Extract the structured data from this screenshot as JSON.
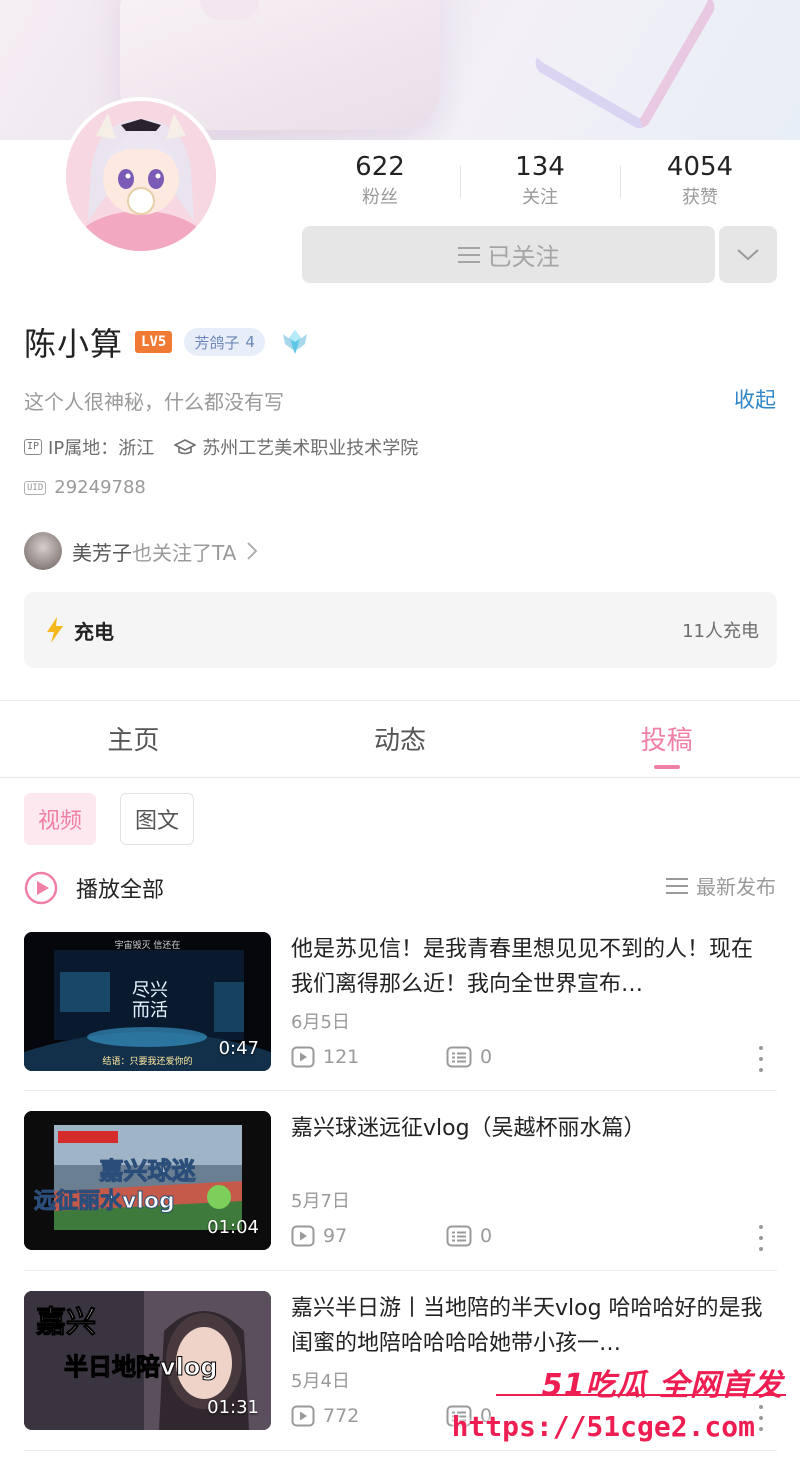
{
  "profile": {
    "stats": [
      {
        "value": "622",
        "label": "粉丝"
      },
      {
        "value": "134",
        "label": "关注"
      },
      {
        "value": "4054",
        "label": "获赞"
      }
    ],
    "follow_label": "已关注",
    "name": "陈小算",
    "level_badge": "LV5",
    "fan_badge_name": "芳鸽子",
    "fan_badge_level": "4",
    "bio": "这个人很神秘，什么都没有写",
    "collapse_label": "收起",
    "ip_tag": "IP",
    "ip_location": "IP属地：浙江",
    "school": "苏州工艺美术职业技术学院",
    "uid_tag": "UID",
    "uid": "29249788",
    "mutual_name": "美芳子",
    "mutual_text": "也关注了TA",
    "charge_label": "充电",
    "charge_count": "11人充电"
  },
  "tabs": [
    {
      "label": "主页"
    },
    {
      "label": "动态"
    },
    {
      "label": "投稿"
    }
  ],
  "filters": [
    {
      "label": "视频"
    },
    {
      "label": "图文"
    }
  ],
  "list_header": {
    "play_all": "播放全部",
    "sort": "最新发布"
  },
  "videos": [
    {
      "title": "他是苏见信！是我青春里想见见不到的人！现在我们离得那么近！我向全世界宣布…",
      "duration": "0:47",
      "date": "6月5日",
      "plays": "121",
      "comments": "0",
      "thumb_caption_top": "宇宙毁灭 信还在",
      "thumb_caption_bottom": "结语：只要我还爱你的"
    },
    {
      "title": "嘉兴球迷远征vlog（吴越杯丽水篇）",
      "duration": "01:04",
      "date": "5月7日",
      "plays": "97",
      "comments": "0",
      "thumb_caption_top": "嘉兴球迷",
      "thumb_caption_bottom": "远征丽水vlog"
    },
    {
      "title": "嘉兴半日游丨当地陪的半天vlog 哈哈哈好的是我闺蜜的地陪哈哈哈哈她带小孩一…",
      "duration": "01:31",
      "date": "5月4日",
      "plays": "772",
      "comments": "0",
      "thumb_caption_top": "嘉兴",
      "thumb_caption_bottom": "半日地陪vlog"
    }
  ],
  "watermark": {
    "line1": "51吃瓜 全网首发",
    "line2": "https://51cge2.com"
  },
  "colors": {
    "accent_pink": "#f07fa7",
    "link_blue": "#2f87c7",
    "level_orange": "#f07933",
    "watermark_red": "#ee1d52"
  }
}
